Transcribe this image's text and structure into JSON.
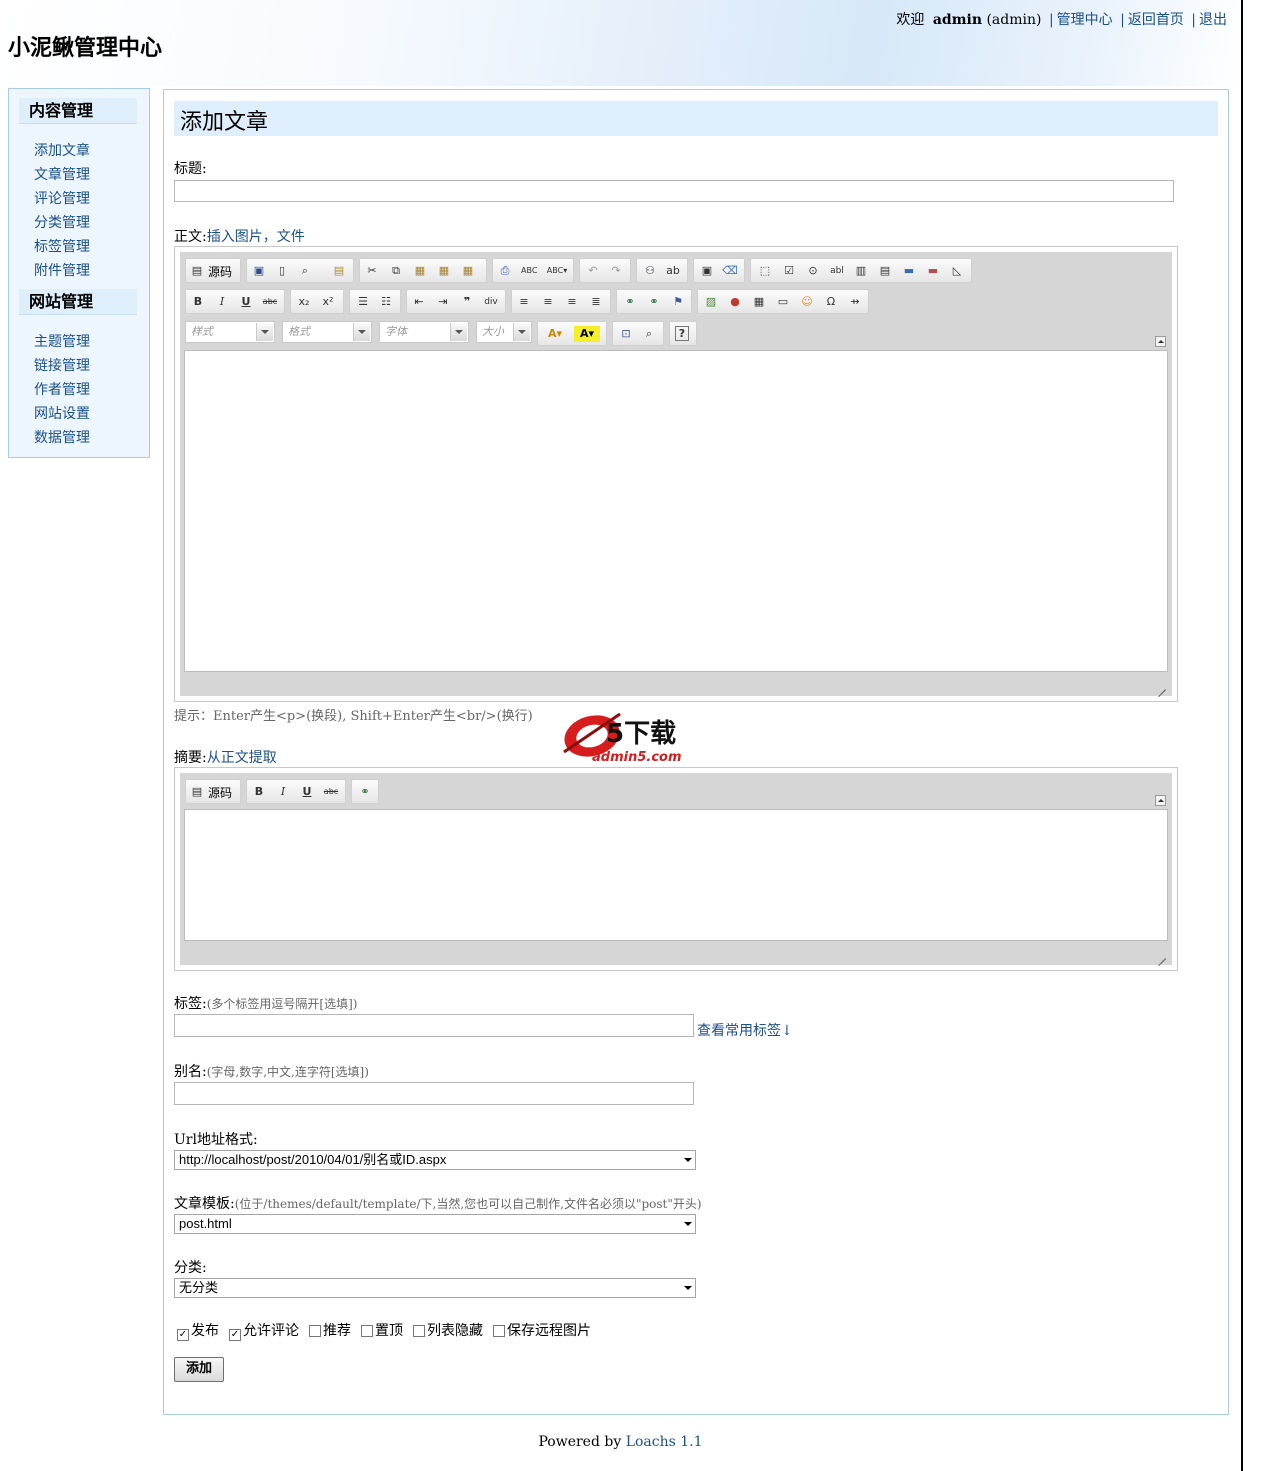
{
  "header": {
    "site_title": "小泥鳅管理中心",
    "welcome": "欢迎",
    "username": "admin",
    "user_role": "(admin)",
    "links": [
      "管理中心",
      "返回首页",
      "退出"
    ]
  },
  "sidebar": {
    "sections": [
      {
        "title": "内容管理",
        "items": [
          "添加文章",
          "文章管理",
          "评论管理",
          "分类管理",
          "标签管理",
          "附件管理"
        ]
      },
      {
        "title": "网站管理",
        "items": [
          "主题管理",
          "链接管理",
          "作者管理",
          "网站设置",
          "数据管理"
        ]
      }
    ]
  },
  "page": {
    "title": "添加文章",
    "title_label": "标题:",
    "body_label": "正文:",
    "body_insert_link": "插入图片，文件",
    "editor_source_label": "源码",
    "editor_combos": [
      "样式",
      "格式",
      "字体",
      "大小"
    ],
    "editor_hint": "提示：Enter产生<p>(换段), Shift+Enter产生<br/>(换行)",
    "summary_label": "摘要:",
    "summary_extract_link": "从正文提取",
    "tags_label": "标签:",
    "tags_hint": "(多个标签用逗号隔开[选填])",
    "tags_common_link": "查看常用标签↓",
    "alias_label": "别名:",
    "alias_hint": "(字母,数字,中文,连字符[选填])",
    "url_label": "Url地址格式:",
    "url_value": "http://localhost/post/2010/04/01/别名或ID.aspx",
    "template_label": "文章模板:",
    "template_hint": "(位于/themes/default/template/下,当然,您也可以自己制作,文件名必须以\"post\"开头)",
    "template_value": "post.html",
    "category_label": "分类:",
    "category_value": "无分类",
    "options": [
      {
        "label": "发布",
        "checked": true
      },
      {
        "label": "允许评论",
        "checked": true
      },
      {
        "label": "推荐",
        "checked": false
      },
      {
        "label": "置顶",
        "checked": false
      },
      {
        "label": "列表隐藏",
        "checked": false
      },
      {
        "label": "保存远程图片",
        "checked": false
      }
    ],
    "submit_label": "添加"
  },
  "watermark": {
    "main": "5下载",
    "sub": "admin5.com"
  },
  "footer": {
    "text": "Powered by",
    "link": "Loachs 1.1"
  },
  "colors": {
    "link": "#1a4f8b",
    "title_bar": "#deeefc",
    "sidebar_bg": "#eef6fd",
    "border": "#a8cbe6"
  }
}
